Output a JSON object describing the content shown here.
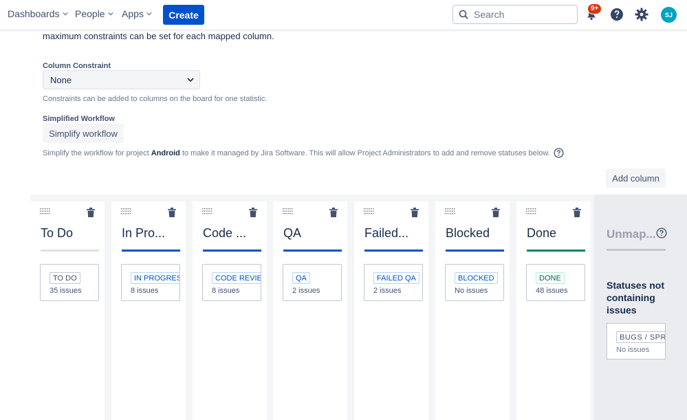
{
  "nav": {
    "dashboards": "Dashboards",
    "people": "People",
    "apps": "Apps",
    "create": "Create",
    "search_placeholder": "Search",
    "notification_badge": "9+",
    "avatar_initials": "SJ"
  },
  "settings": {
    "intro_text": "maximum constraints can be set for each mapped column.",
    "column_constraint_label": "Column Constraint",
    "column_constraint_value": "None",
    "constraint_help": "Constraints can be added to columns on the board for one statistic.",
    "simplified_workflow_label": "Simplified Workflow",
    "simplify_button": "Simplify workflow",
    "simplify_help_prefix": "Simplify the workflow for project ",
    "simplify_help_project": "Android",
    "simplify_help_suffix": " to make it managed by Jira Software. This will allow Project Administrators to add and remove statuses below.",
    "add_column_button": "Add column"
  },
  "columns": [
    {
      "title": "To Do",
      "status": "TO DO",
      "count": "35 issues",
      "style": "todo"
    },
    {
      "title": "In Pro...",
      "status": "IN PROGRESS",
      "count": "8 issues",
      "style": "progress"
    },
    {
      "title": "Code ...",
      "status": "CODE REVIEW",
      "count": "8 issues",
      "style": "progress"
    },
    {
      "title": "QA",
      "status": "QA",
      "count": "2 issues",
      "style": "progress"
    },
    {
      "title": "Failed...",
      "status": "FAILED QA",
      "count": "2 issues",
      "style": "progress"
    },
    {
      "title": "Blocked",
      "status": "BLOCKED",
      "count": "No issues",
      "style": "progress"
    },
    {
      "title": "Done",
      "status": "DONE",
      "count": "48 issues",
      "style": "done"
    }
  ],
  "unmapped": {
    "title": "Unmap...",
    "description": "Statuses not containing issues",
    "card_status": "BUGS / SPRINT",
    "card_count": "No issues"
  },
  "colors": {
    "primary": "#0052cc",
    "done": "#00875a",
    "todo_rule": "#dfe1e6",
    "badge": "#de350b"
  }
}
